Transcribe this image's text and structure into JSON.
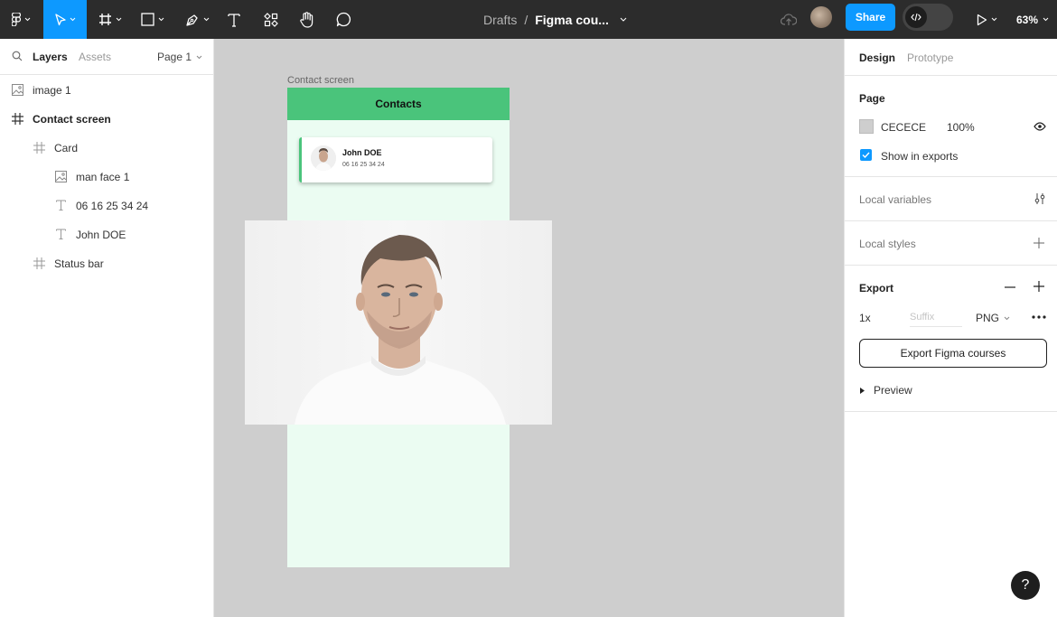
{
  "toolbar": {
    "file_breadcrumb": "Drafts",
    "separator": "/",
    "file_name": "Figma cou...",
    "share_label": "Share",
    "zoom": "63%"
  },
  "left_panel": {
    "tab_layers": "Layers",
    "tab_assets": "Assets",
    "page_selector": "Page 1",
    "layers": [
      {
        "name": "image 1",
        "icon": "image-icon"
      },
      {
        "name": "Contact screen",
        "icon": "frame-icon"
      },
      {
        "name": "Card",
        "icon": "frame-icon"
      },
      {
        "name": "man face 1",
        "icon": "image-icon"
      },
      {
        "name": "06 16 25 34 24",
        "icon": "text-icon"
      },
      {
        "name": "John DOE",
        "icon": "text-icon"
      },
      {
        "name": "Status bar",
        "icon": "frame-icon"
      }
    ]
  },
  "canvas": {
    "frame_label": "Contact screen",
    "status_bar_title": "Contacts",
    "card": {
      "name": "John DOE",
      "phone": "06 16 25 34 24"
    },
    "frame_bg": "#ebfcf2",
    "accent": "#4ac47b"
  },
  "right_panel": {
    "tab_design": "Design",
    "tab_prototype": "Prototype",
    "page_title": "Page",
    "page_color": "CECECE",
    "page_opacity": "100%",
    "show_in_exports": "Show in exports",
    "local_variables": "Local variables",
    "local_styles": "Local styles",
    "export_title": "Export",
    "export_scale": "1x",
    "export_suffix_placeholder": "Suffix",
    "export_format": "PNG",
    "export_button": "Export Figma courses",
    "preview": "Preview"
  },
  "help": "?"
}
